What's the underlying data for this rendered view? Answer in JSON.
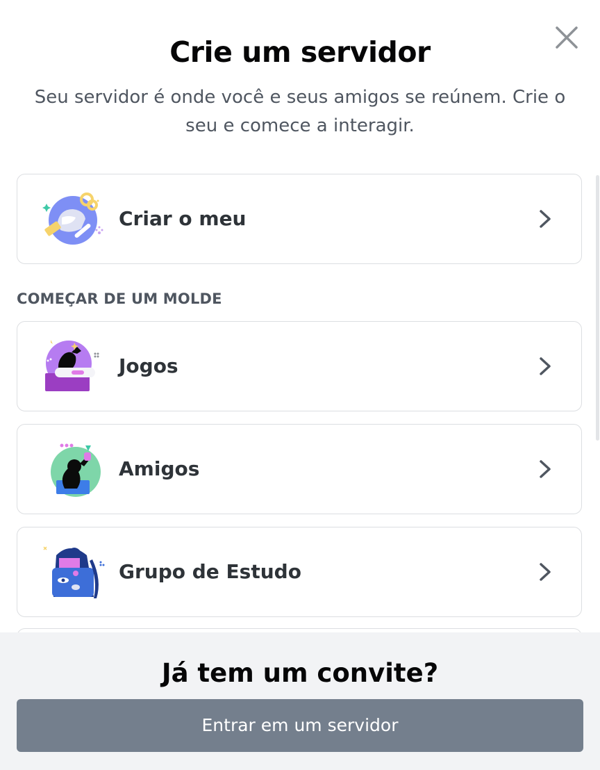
{
  "modal": {
    "title": "Crie um servidor",
    "subtitle": "Seu servidor é onde você e seus amigos se reúnem. Crie o seu e comece a interagir.",
    "close_icon": "close-icon"
  },
  "create_own": {
    "label": "Criar o meu",
    "icon": "create-server-icon"
  },
  "templates": {
    "section_header": "COMEÇAR DE UM MOLDE",
    "items": [
      {
        "label": "Jogos",
        "icon": "gaming-icon"
      },
      {
        "label": "Amigos",
        "icon": "friends-icon"
      },
      {
        "label": "Grupo de Estudo",
        "icon": "study-group-icon"
      }
    ]
  },
  "footer": {
    "title": "Já tem um convite?",
    "join_button_label": "Entrar em um servidor"
  },
  "colors": {
    "join_button_bg": "#747f8d",
    "footer_bg": "#f2f3f5",
    "title_text": "#060607",
    "body_text": "#4f5660"
  }
}
